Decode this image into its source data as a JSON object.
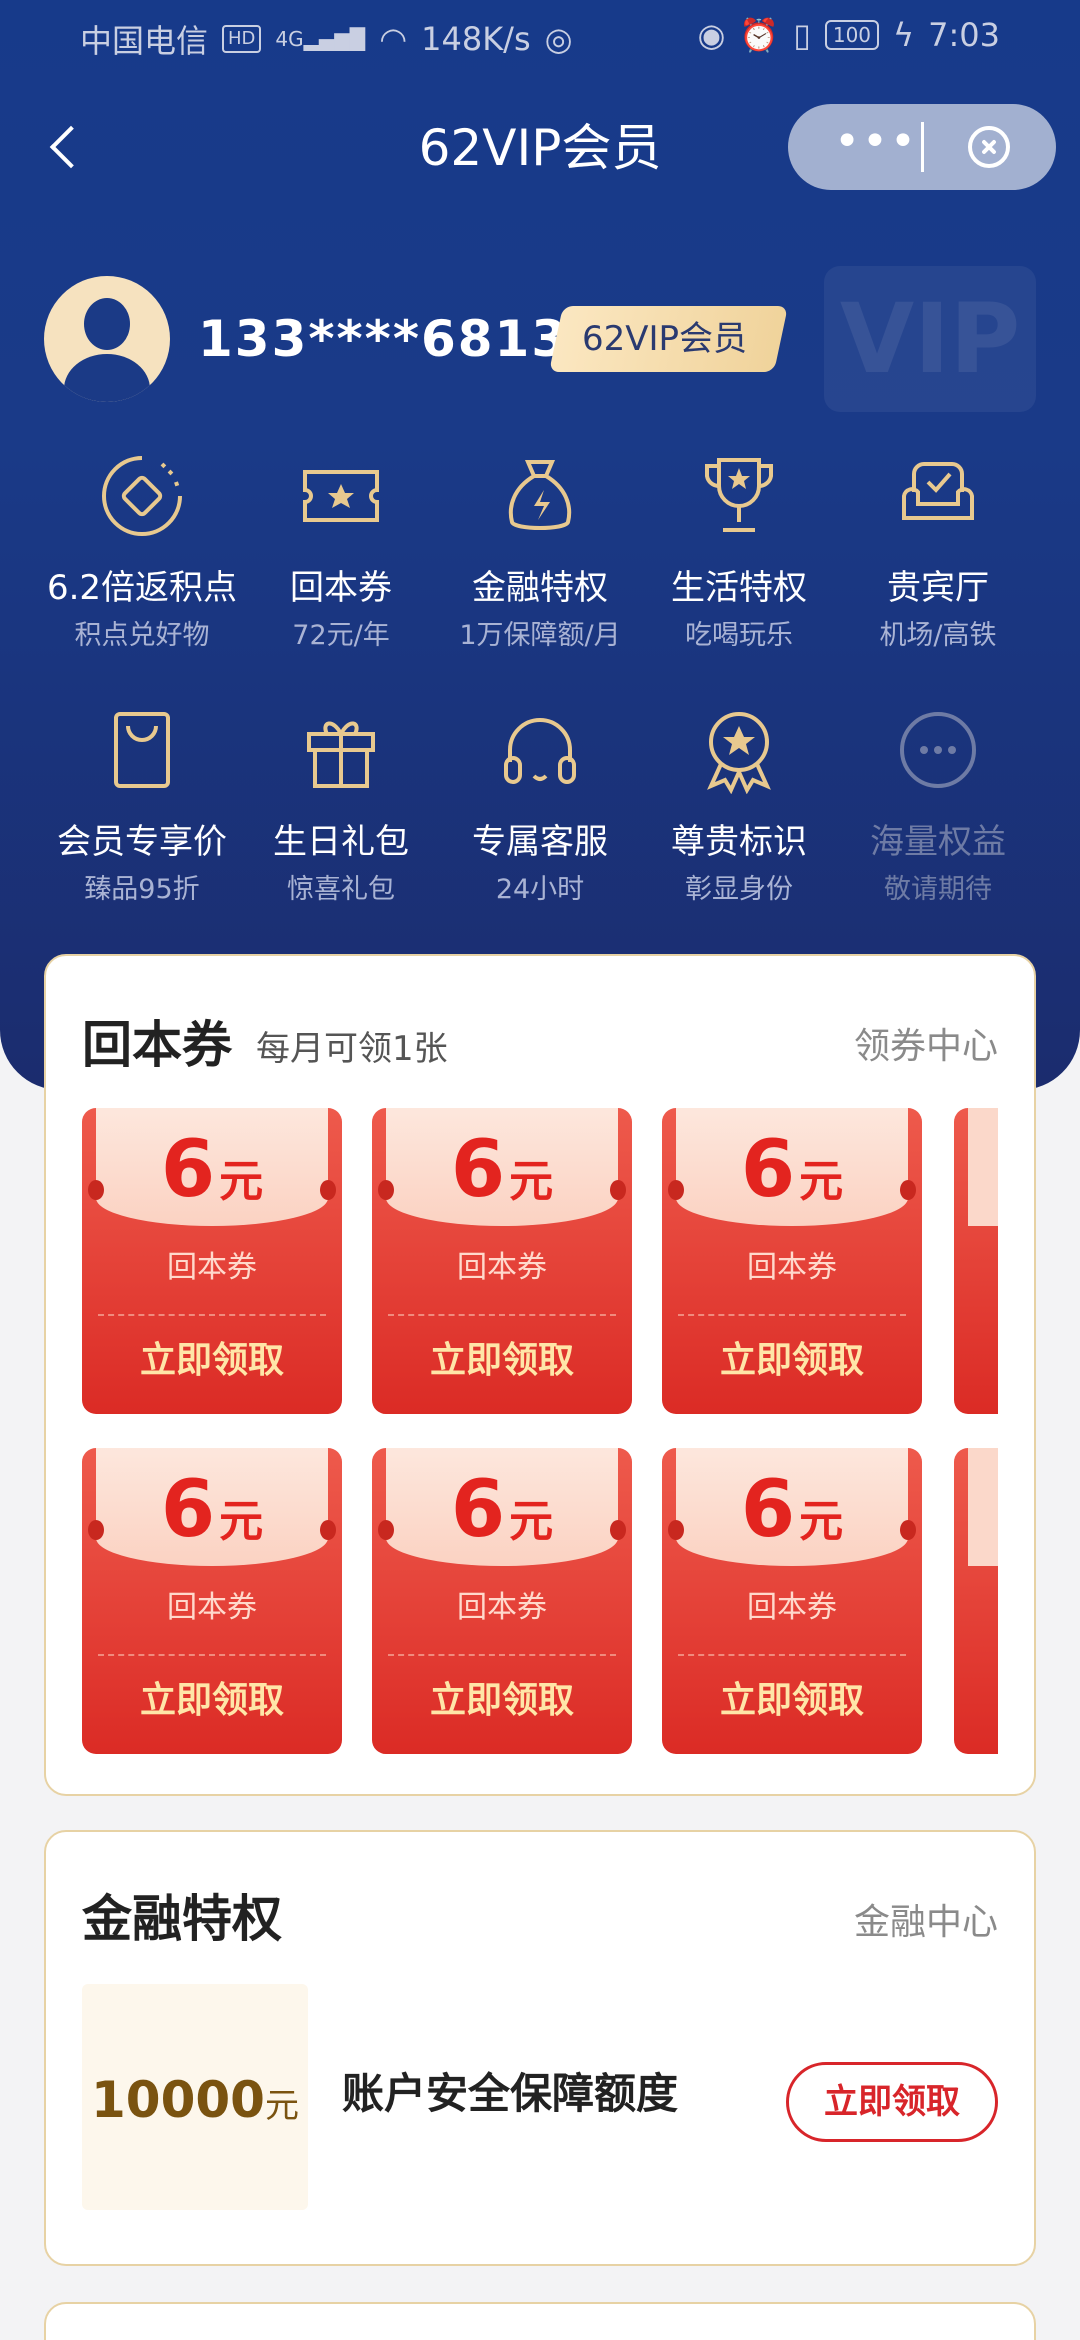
{
  "status_bar": {
    "carrier": "中国电信",
    "hd": "HD",
    "net": "4G",
    "speed": "148K/s",
    "battery": "100",
    "time": "7:03"
  },
  "nav": {
    "title": "62VIP会员",
    "more": "•••"
  },
  "user": {
    "phone": "133****6813",
    "badge": "62VIP会员",
    "watermark": "VIP"
  },
  "benefits": [
    {
      "icon": "diamond-circle-icon",
      "title": "6.2倍返积点",
      "sub": "积点兑好物"
    },
    {
      "icon": "ticket-star-icon",
      "title": "回本券",
      "sub": "72元/年"
    },
    {
      "icon": "money-bag-icon",
      "title": "金融特权",
      "sub": "1万保障额/月"
    },
    {
      "icon": "trophy-icon",
      "title": "生活特权",
      "sub": "吃喝玩乐"
    },
    {
      "icon": "sofa-icon",
      "title": "贵宾厅",
      "sub": "机场/高铁"
    },
    {
      "icon": "shopping-bag-icon",
      "title": "会员专享价",
      "sub": "臻品95折"
    },
    {
      "icon": "gift-icon",
      "title": "生日礼包",
      "sub": "惊喜礼包"
    },
    {
      "icon": "headset-icon",
      "title": "专属客服",
      "sub": "24小时"
    },
    {
      "icon": "medal-icon",
      "title": "尊贵标识",
      "sub": "彰显身份"
    },
    {
      "icon": "more-icon",
      "title": "海量权益",
      "sub": "敬请期待"
    }
  ],
  "coupon_card": {
    "title": "回本券",
    "subtitle": "每月可领1张",
    "link": "领券中心",
    "coupon": {
      "amount": "6",
      "unit": "元",
      "label": "回本券",
      "action": "立即领取"
    },
    "rows": 2,
    "visible_per_row": 3
  },
  "finance_card": {
    "title": "金融特权",
    "link": "金融中心",
    "amount": "10000",
    "unit": "元",
    "item_title": "账户安全保障额度",
    "action": "立即领取"
  },
  "colors": {
    "hero_bg": "#1a3a88",
    "gold": "#e8c98f",
    "coupon_red": "#e33e35",
    "action_red": "#d8252a"
  }
}
